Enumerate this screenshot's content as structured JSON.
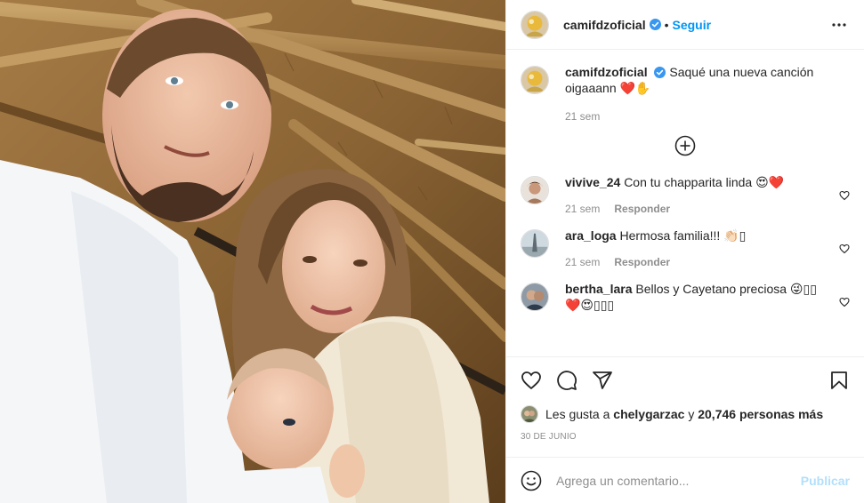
{
  "post": {
    "author": "camifdzoficial",
    "follow_label": "Seguir",
    "dot": "•",
    "more_icon": "more-horizontal-icon"
  },
  "caption": {
    "username": "camifdzoficial",
    "text": "Saqué una nueva canción oigaaann ❤️✋",
    "time": "21 sem"
  },
  "load_more_icon": "plus-circle-icon",
  "comments": [
    {
      "username": "vivive_24",
      "text": "Con tu chapparita linda 😍❤️",
      "time": "21 sem",
      "reply": "Responder"
    },
    {
      "username": "ara_loga",
      "text": "Hermosa familia!!! 👏🏻▯",
      "time": "21 sem",
      "reply": "Responder"
    },
    {
      "username": "bertha_lara",
      "text": "Bellos y Cayetano preciosa 😜▯▯❤️😍▯▯▯",
      "time": "",
      "reply": ""
    }
  ],
  "actions": {
    "like_icon": "heart-icon",
    "comment_icon": "comment-icon",
    "share_icon": "share-icon",
    "save_icon": "bookmark-icon"
  },
  "likes": {
    "prefix": "Les gusta a",
    "user": "chelygarzac",
    "joiner": "y",
    "count": "20,746 personas más"
  },
  "date": "30 DE JUNIO",
  "add_comment": {
    "placeholder": "Agrega un comentario...",
    "publish_label": "Publicar"
  },
  "colors": {
    "accent": "#0095f6",
    "publish_disabled": "#b2dffc",
    "muted": "#8e8e8e",
    "verified": "#3897f0"
  }
}
